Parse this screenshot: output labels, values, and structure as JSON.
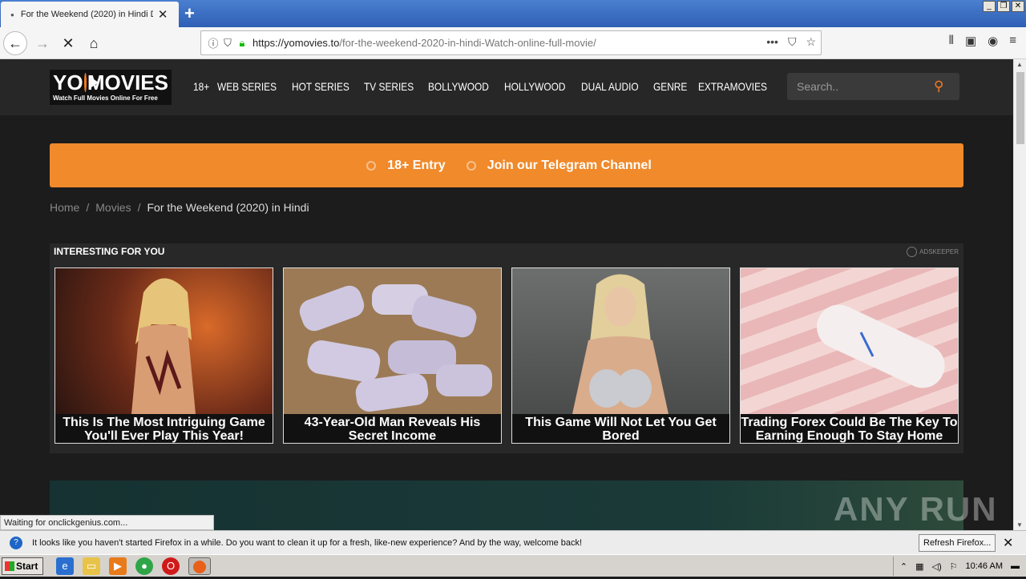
{
  "browser": {
    "tab_title": "For the Weekend (2020) in Hindi D",
    "url_host": "https://yomovies.to",
    "url_path": "/for-the-weekend-2020-in-hindi-Watch-online-full-movie/",
    "status_text": "Waiting for onclickgenius.com...",
    "notification_text": "It looks like you haven't started Firefox in a while. Do you want to clean it up for a fresh, like-new experience? And by the way, welcome back!",
    "refresh_button": "Refresh Firefox..."
  },
  "site": {
    "logo_main_left": "YO",
    "logo_main_right": "MOVIES",
    "logo_tagline": "Watch Full Movies Online For Free",
    "menu": [
      "18+",
      "WEB SERIES",
      "HOT SERIES",
      "TV SERIES",
      "BOLLYWOOD",
      "HOLLYWOOD",
      "DUAL AUDIO",
      "GENRE",
      "EXTRAMOVIES"
    ],
    "search_placeholder": "Search..",
    "banner_left": "18+ Entry",
    "banner_right": "Join our Telegram Channel",
    "breadcrumb": [
      "Home",
      "Movies",
      "For the Weekend (2020) in Hindi"
    ],
    "accent_color": "#f08a2b"
  },
  "ads": {
    "title": "INTERESTING FOR YOU",
    "brand": "ADSKEEPER",
    "cards": [
      "This Is The Most Intriguing Game You'll Ever Play This Year!",
      "43-Year-Old Man Reveals His Secret Income",
      "This Game Will Not Let You Get Bored",
      "Trading Forex Could Be The Key To Earning Enough To Stay Home"
    ]
  },
  "watermark": "ANY RUN",
  "taskbar": {
    "start": "Start",
    "clock": "10:46 AM"
  }
}
